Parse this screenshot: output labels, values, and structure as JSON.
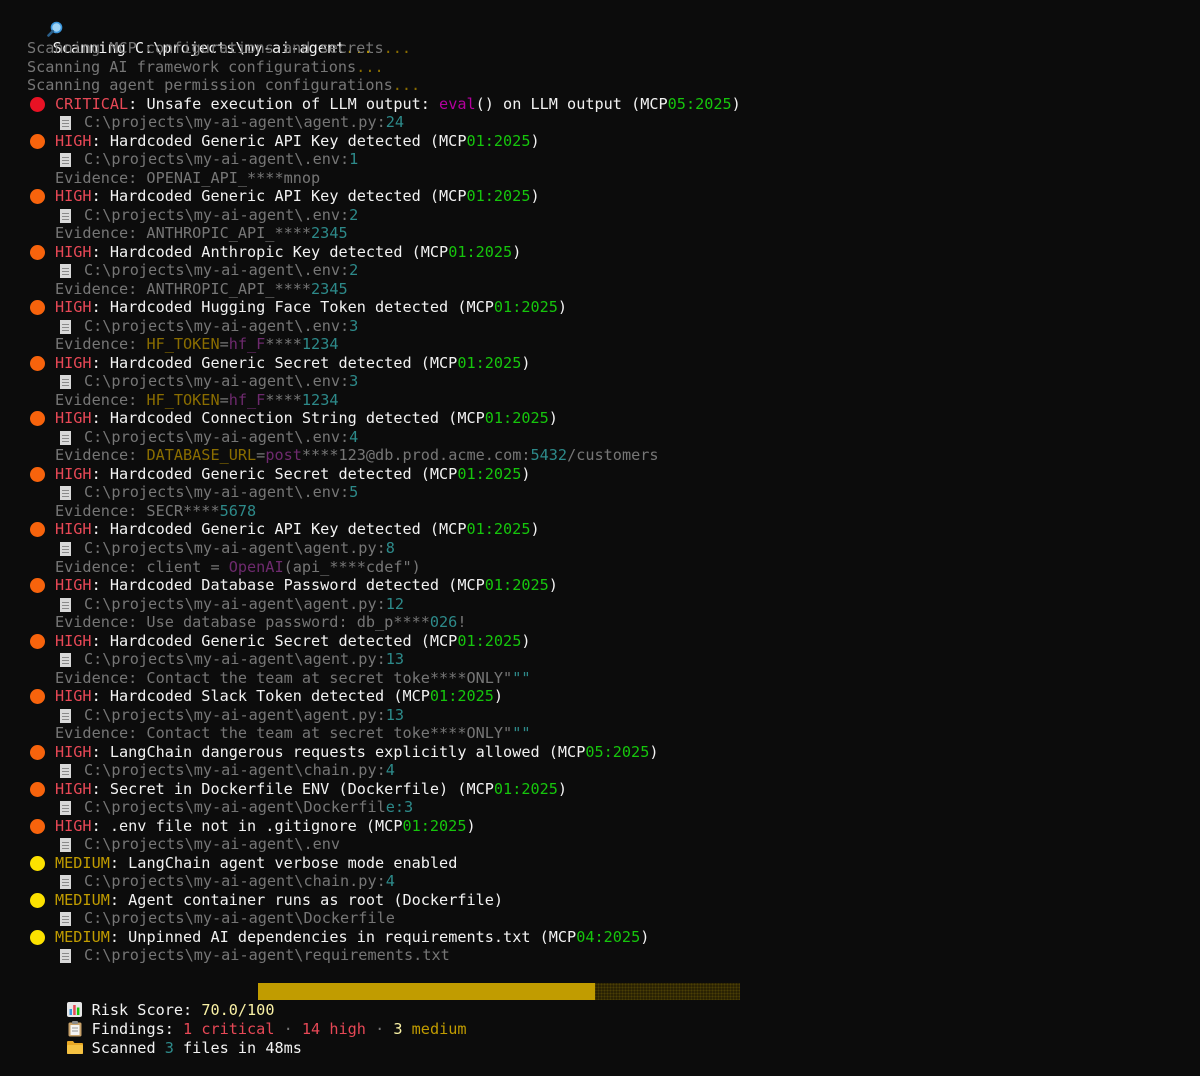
{
  "header": {
    "icon": "magnifier-icon",
    "text": "Scanning C:\\projects\\my-ai-agent",
    "dots": "..."
  },
  "scan_steps": [
    {
      "text": "Scanning MCP configurations and secrets",
      "dots": "..."
    },
    {
      "text": "Scanning AI framework configurations",
      "dots": "..."
    },
    {
      "text": "Scanning agent permission configurations",
      "dots": "..."
    }
  ],
  "lines": [
    {
      "kind": "finding",
      "severity": "critical",
      "parts": [
        {
          "t": "CRITICAL",
          "c": "red"
        },
        {
          "t": ": Unsafe execution of LLM output: ",
          "c": "w"
        },
        {
          "t": "eval",
          "c": "mag"
        },
        {
          "t": "() on LLM output (MCP",
          "c": "w"
        },
        {
          "t": "05:2025",
          "c": "grn"
        },
        {
          "t": ")",
          "c": "w"
        }
      ]
    },
    {
      "kind": "file",
      "parts": [
        {
          "t": "C:\\projects\\my-ai-agent\\agent.py:",
          "c": "g"
        },
        {
          "t": "24",
          "c": "teal"
        }
      ]
    },
    {
      "kind": "finding",
      "severity": "high",
      "parts": [
        {
          "t": "HIGH",
          "c": "red"
        },
        {
          "t": ": Hardcoded Generic API Key detected (MCP",
          "c": "w"
        },
        {
          "t": "01:2025",
          "c": "grn"
        },
        {
          "t": ")",
          "c": "w"
        }
      ]
    },
    {
      "kind": "file",
      "parts": [
        {
          "t": "C:\\projects\\my-ai-agent\\.env:",
          "c": "g"
        },
        {
          "t": "1",
          "c": "teal"
        }
      ]
    },
    {
      "kind": "evidence",
      "parts": [
        {
          "t": "Evidence: OPENAI_API_****mnop",
          "c": "g"
        }
      ]
    },
    {
      "kind": "finding",
      "severity": "high",
      "parts": [
        {
          "t": "HIGH",
          "c": "red"
        },
        {
          "t": ": Hardcoded Generic API Key detected (MCP",
          "c": "w"
        },
        {
          "t": "01:2025",
          "c": "grn"
        },
        {
          "t": ")",
          "c": "w"
        }
      ]
    },
    {
      "kind": "file",
      "parts": [
        {
          "t": "C:\\projects\\my-ai-agent\\.env:",
          "c": "g"
        },
        {
          "t": "2",
          "c": "teal"
        }
      ]
    },
    {
      "kind": "evidence",
      "parts": [
        {
          "t": "Evidence: ANTHROPIC_API_****",
          "c": "g"
        },
        {
          "t": "2345",
          "c": "teal"
        }
      ]
    },
    {
      "kind": "finding",
      "severity": "high",
      "parts": [
        {
          "t": "HIGH",
          "c": "red"
        },
        {
          "t": ": Hardcoded Anthropic Key detected (MCP",
          "c": "w"
        },
        {
          "t": "01:2025",
          "c": "grn"
        },
        {
          "t": ")",
          "c": "w"
        }
      ]
    },
    {
      "kind": "file",
      "parts": [
        {
          "t": "C:\\projects\\my-ai-agent\\.env:",
          "c": "g"
        },
        {
          "t": "2",
          "c": "teal"
        }
      ]
    },
    {
      "kind": "evidence",
      "parts": [
        {
          "t": "Evidence: ANTHROPIC_API_****",
          "c": "g"
        },
        {
          "t": "2345",
          "c": "teal"
        }
      ]
    },
    {
      "kind": "finding",
      "severity": "high",
      "parts": [
        {
          "t": "HIGH",
          "c": "red"
        },
        {
          "t": ": Hardcoded Hugging Face Token detected (MCP",
          "c": "w"
        },
        {
          "t": "01:2025",
          "c": "grn"
        },
        {
          "t": ")",
          "c": "w"
        }
      ]
    },
    {
      "kind": "file",
      "parts": [
        {
          "t": "C:\\projects\\my-ai-agent\\.env:",
          "c": "g"
        },
        {
          "t": "3",
          "c": "teal"
        }
      ]
    },
    {
      "kind": "evidence",
      "parts": [
        {
          "t": "Evidence: ",
          "c": "g"
        },
        {
          "t": "HF_TOKEN",
          "c": "olive"
        },
        {
          "t": "=",
          "c": "g"
        },
        {
          "t": "hf_F",
          "c": "dmag"
        },
        {
          "t": "****",
          "c": "g"
        },
        {
          "t": "1234",
          "c": "teal"
        }
      ]
    },
    {
      "kind": "finding",
      "severity": "high",
      "parts": [
        {
          "t": "HIGH",
          "c": "red"
        },
        {
          "t": ": Hardcoded Generic Secret detected (MCP",
          "c": "w"
        },
        {
          "t": "01:2025",
          "c": "grn"
        },
        {
          "t": ")",
          "c": "w"
        }
      ]
    },
    {
      "kind": "file",
      "parts": [
        {
          "t": "C:\\projects\\my-ai-agent\\.env:",
          "c": "g"
        },
        {
          "t": "3",
          "c": "teal"
        }
      ]
    },
    {
      "kind": "evidence",
      "parts": [
        {
          "t": "Evidence: ",
          "c": "g"
        },
        {
          "t": "HF_TOKEN",
          "c": "olive"
        },
        {
          "t": "=",
          "c": "g"
        },
        {
          "t": "hf_F",
          "c": "dmag"
        },
        {
          "t": "****",
          "c": "g"
        },
        {
          "t": "1234",
          "c": "teal"
        }
      ]
    },
    {
      "kind": "finding",
      "severity": "high",
      "parts": [
        {
          "t": "HIGH",
          "c": "red"
        },
        {
          "t": ": Hardcoded Connection String detected (MCP",
          "c": "w"
        },
        {
          "t": "01:2025",
          "c": "grn"
        },
        {
          "t": ")",
          "c": "w"
        }
      ]
    },
    {
      "kind": "file",
      "parts": [
        {
          "t": "C:\\projects\\my-ai-agent\\.env:",
          "c": "g"
        },
        {
          "t": "4",
          "c": "teal"
        }
      ]
    },
    {
      "kind": "evidence",
      "parts": [
        {
          "t": "Evidence: ",
          "c": "g"
        },
        {
          "t": "DATABASE_URL",
          "c": "olive"
        },
        {
          "t": "=",
          "c": "g"
        },
        {
          "t": "post",
          "c": "dmag"
        },
        {
          "t": "****123@db.prod.acme.com:",
          "c": "g"
        },
        {
          "t": "5432",
          "c": "teal"
        },
        {
          "t": "/customers",
          "c": "g"
        }
      ]
    },
    {
      "kind": "finding",
      "severity": "high",
      "parts": [
        {
          "t": "HIGH",
          "c": "red"
        },
        {
          "t": ": Hardcoded Generic Secret detected (MCP",
          "c": "w"
        },
        {
          "t": "01:2025",
          "c": "grn"
        },
        {
          "t": ")",
          "c": "w"
        }
      ]
    },
    {
      "kind": "file",
      "parts": [
        {
          "t": "C:\\projects\\my-ai-agent\\.env:",
          "c": "g"
        },
        {
          "t": "5",
          "c": "teal"
        }
      ]
    },
    {
      "kind": "evidence",
      "parts": [
        {
          "t": "Evidence: SECR****",
          "c": "g"
        },
        {
          "t": "5678",
          "c": "teal"
        }
      ]
    },
    {
      "kind": "finding",
      "severity": "high",
      "parts": [
        {
          "t": "HIGH",
          "c": "red"
        },
        {
          "t": ": Hardcoded Generic API Key detected (MCP",
          "c": "w"
        },
        {
          "t": "01:2025",
          "c": "grn"
        },
        {
          "t": ")",
          "c": "w"
        }
      ]
    },
    {
      "kind": "file",
      "parts": [
        {
          "t": "C:\\projects\\my-ai-agent\\agent.py:",
          "c": "g"
        },
        {
          "t": "8",
          "c": "teal"
        }
      ]
    },
    {
      "kind": "evidence",
      "parts": [
        {
          "t": "Evidence: client = ",
          "c": "g"
        },
        {
          "t": "OpenAI",
          "c": "dmag"
        },
        {
          "t": "(api_****cdef\")",
          "c": "g"
        }
      ]
    },
    {
      "kind": "finding",
      "severity": "high",
      "parts": [
        {
          "t": "HIGH",
          "c": "red"
        },
        {
          "t": ": Hardcoded Database Password detected (MCP",
          "c": "w"
        },
        {
          "t": "01:2025",
          "c": "grn"
        },
        {
          "t": ")",
          "c": "w"
        }
      ]
    },
    {
      "kind": "file",
      "parts": [
        {
          "t": "C:\\projects\\my-ai-agent\\agent.py:",
          "c": "g"
        },
        {
          "t": "12",
          "c": "teal"
        }
      ]
    },
    {
      "kind": "evidence",
      "parts": [
        {
          "t": "Evidence: Use database password: db_p****",
          "c": "g"
        },
        {
          "t": "026",
          "c": "teal"
        },
        {
          "t": "!",
          "c": "g"
        }
      ]
    },
    {
      "kind": "finding",
      "severity": "high",
      "parts": [
        {
          "t": "HIGH",
          "c": "red"
        },
        {
          "t": ": Hardcoded Generic Secret detected (MCP",
          "c": "w"
        },
        {
          "t": "01:2025",
          "c": "grn"
        },
        {
          "t": ")",
          "c": "w"
        }
      ]
    },
    {
      "kind": "file",
      "parts": [
        {
          "t": "C:\\projects\\my-ai-agent\\agent.py:",
          "c": "g"
        },
        {
          "t": "13",
          "c": "teal"
        }
      ]
    },
    {
      "kind": "evidence",
      "parts": [
        {
          "t": "Evidence: Contact the team at secret toke****ONLY\"",
          "c": "g"
        },
        {
          "t": "\"\"",
          "c": "teal"
        }
      ]
    },
    {
      "kind": "finding",
      "severity": "high",
      "parts": [
        {
          "t": "HIGH",
          "c": "red"
        },
        {
          "t": ": Hardcoded Slack Token detected (MCP",
          "c": "w"
        },
        {
          "t": "01:2025",
          "c": "grn"
        },
        {
          "t": ")",
          "c": "w"
        }
      ]
    },
    {
      "kind": "file",
      "parts": [
        {
          "t": "C:\\projects\\my-ai-agent\\agent.py:",
          "c": "g"
        },
        {
          "t": "13",
          "c": "teal"
        }
      ]
    },
    {
      "kind": "evidence",
      "parts": [
        {
          "t": "Evidence: Contact the team at secret toke****ONLY\"",
          "c": "g"
        },
        {
          "t": "\"\"",
          "c": "teal"
        }
      ]
    },
    {
      "kind": "finding",
      "severity": "high",
      "parts": [
        {
          "t": "HIGH",
          "c": "red"
        },
        {
          "t": ": LangChain dangerous requests explicitly allowed (MCP",
          "c": "w"
        },
        {
          "t": "05:2025",
          "c": "grn"
        },
        {
          "t": ")",
          "c": "w"
        }
      ]
    },
    {
      "kind": "file",
      "parts": [
        {
          "t": "C:\\projects\\my-ai-agent\\chain.py:",
          "c": "g"
        },
        {
          "t": "4",
          "c": "teal"
        }
      ]
    },
    {
      "kind": "finding",
      "severity": "high",
      "parts": [
        {
          "t": "HIGH",
          "c": "red"
        },
        {
          "t": ": Secret in Dockerfile ENV (Dockerfile) (MCP",
          "c": "w"
        },
        {
          "t": "01:2025",
          "c": "grn"
        },
        {
          "t": ")",
          "c": "w"
        }
      ]
    },
    {
      "kind": "file",
      "parts": [
        {
          "t": "C:\\projects\\my-ai-agent\\Dockerfil",
          "c": "g"
        },
        {
          "t": "e:3",
          "c": "teal"
        }
      ]
    },
    {
      "kind": "finding",
      "severity": "high",
      "parts": [
        {
          "t": "HIGH",
          "c": "red"
        },
        {
          "t": ": .env file not in .gitignore (MCP",
          "c": "w"
        },
        {
          "t": "01:2025",
          "c": "grn"
        },
        {
          "t": ")",
          "c": "w"
        }
      ]
    },
    {
      "kind": "file",
      "parts": [
        {
          "t": "C:\\projects\\my-ai-agent\\.env",
          "c": "g"
        }
      ]
    },
    {
      "kind": "finding",
      "severity": "medium",
      "parts": [
        {
          "t": "MEDIUM",
          "c": "yel"
        },
        {
          "t": ": LangChain agent verbose mode enabled",
          "c": "w"
        }
      ]
    },
    {
      "kind": "file",
      "parts": [
        {
          "t": "C:\\projects\\my-ai-agent\\chain.py:",
          "c": "g"
        },
        {
          "t": "4",
          "c": "teal"
        }
      ]
    },
    {
      "kind": "finding",
      "severity": "medium",
      "parts": [
        {
          "t": "MEDIUM",
          "c": "yel"
        },
        {
          "t": ": Agent container runs as root (Dockerfile)",
          "c": "w"
        }
      ]
    },
    {
      "kind": "file",
      "parts": [
        {
          "t": "C:\\projects\\my-ai-agent\\Dockerfile",
          "c": "g"
        }
      ]
    },
    {
      "kind": "finding",
      "severity": "medium",
      "parts": [
        {
          "t": "MEDIUM",
          "c": "yel"
        },
        {
          "t": ": Unpinned AI dependencies in requirements.txt (MCP",
          "c": "w"
        },
        {
          "t": "04:2025",
          "c": "grn"
        },
        {
          "t": ")",
          "c": "w"
        }
      ]
    },
    {
      "kind": "file",
      "parts": [
        {
          "t": "C:\\projects\\my-ai-agent\\requirements.txt",
          "c": "g"
        }
      ]
    }
  ],
  "summary": {
    "risk": {
      "icon": "bar-chart-icon",
      "label": "Risk Score: ",
      "value": "70.0/100",
      "score_fraction": 0.7
    },
    "findings": {
      "icon": "clipboard-icon",
      "label": "Findings: ",
      "critical_count": "1",
      "critical_label": " critical",
      "sep": " · ",
      "high_count": "14",
      "high_label": " high",
      "medium_count": "3",
      "medium_label": " medium"
    },
    "scanned": {
      "icon": "folder-icon",
      "prefix": "Scanned ",
      "count": "3",
      "suffix": " files in 48ms"
    }
  }
}
